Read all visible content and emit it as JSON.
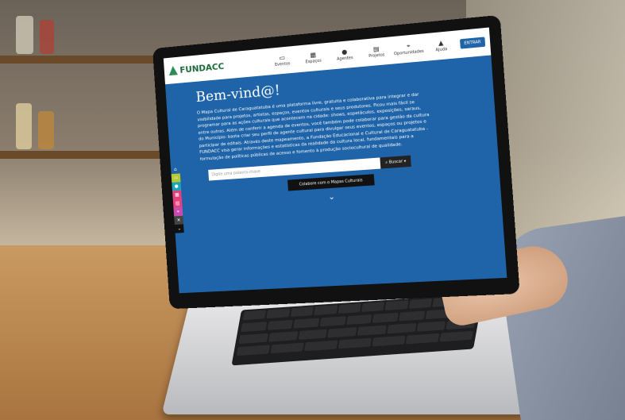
{
  "site": {
    "logo_text": "FUNDACC",
    "nav": [
      {
        "label": "Eventos",
        "icon": "calendar-icon"
      },
      {
        "label": "Espaços",
        "icon": "building-icon"
      },
      {
        "label": "Agentes",
        "icon": "person-icon"
      },
      {
        "label": "Projetos",
        "icon": "folder-icon"
      },
      {
        "label": "Oportunidades",
        "icon": "pin-icon"
      },
      {
        "label": "Ajuda",
        "icon": "help-icon"
      }
    ],
    "login_label": "ENTRAR"
  },
  "hero": {
    "title": "Bem-vind@!",
    "intro": "O Mapa Cultural de Caraguatatuba é uma plataforma livre, gratuita e colaborativa para integrar e dar visibilidade para projetos, artistas, espaços, eventos culturais e seus produtores. Ficou mais fácil se programar para as ações culturais que acontecem na cidade: shows, espetáculos, exposições, saraus, entre outras. Além de conferir a agenda de eventos, você também pode colaborar para gestão da cultura do Município: basta criar seu perfil de agente cultural para divulgar seus eventos, espaços ou projetos e participar de editais. Através deste mapeamento, a Fundação Educacional e Cultural de Caraguatatuba - FUNDACC visa gerar informações e estatísticas da realidade da cultura local, fundamentais para a formulação de políticas públicas de acesso e fomento à produção sociocultural de qualidade.",
    "search_placeholder": "Digite uma palavra-chave",
    "search_button": "Buscar",
    "cta_label": "Colabore com o Mapas Culturais"
  },
  "side_icons": [
    {
      "icon": "home-icon",
      "color": "#1f64a8"
    },
    {
      "icon": "calendar-icon",
      "color": "#b5c934"
    },
    {
      "icon": "person-icon",
      "color": "#1aa6b7"
    },
    {
      "icon": "building-icon",
      "color": "#e6407a"
    },
    {
      "icon": "folder-icon",
      "color": "#e6407a"
    },
    {
      "icon": "pin-icon",
      "color": "#c84cb0"
    },
    {
      "icon": "tools-icon",
      "color": "#444444"
    },
    {
      "icon": "chevron-down-icon",
      "color": "#111111"
    }
  ]
}
